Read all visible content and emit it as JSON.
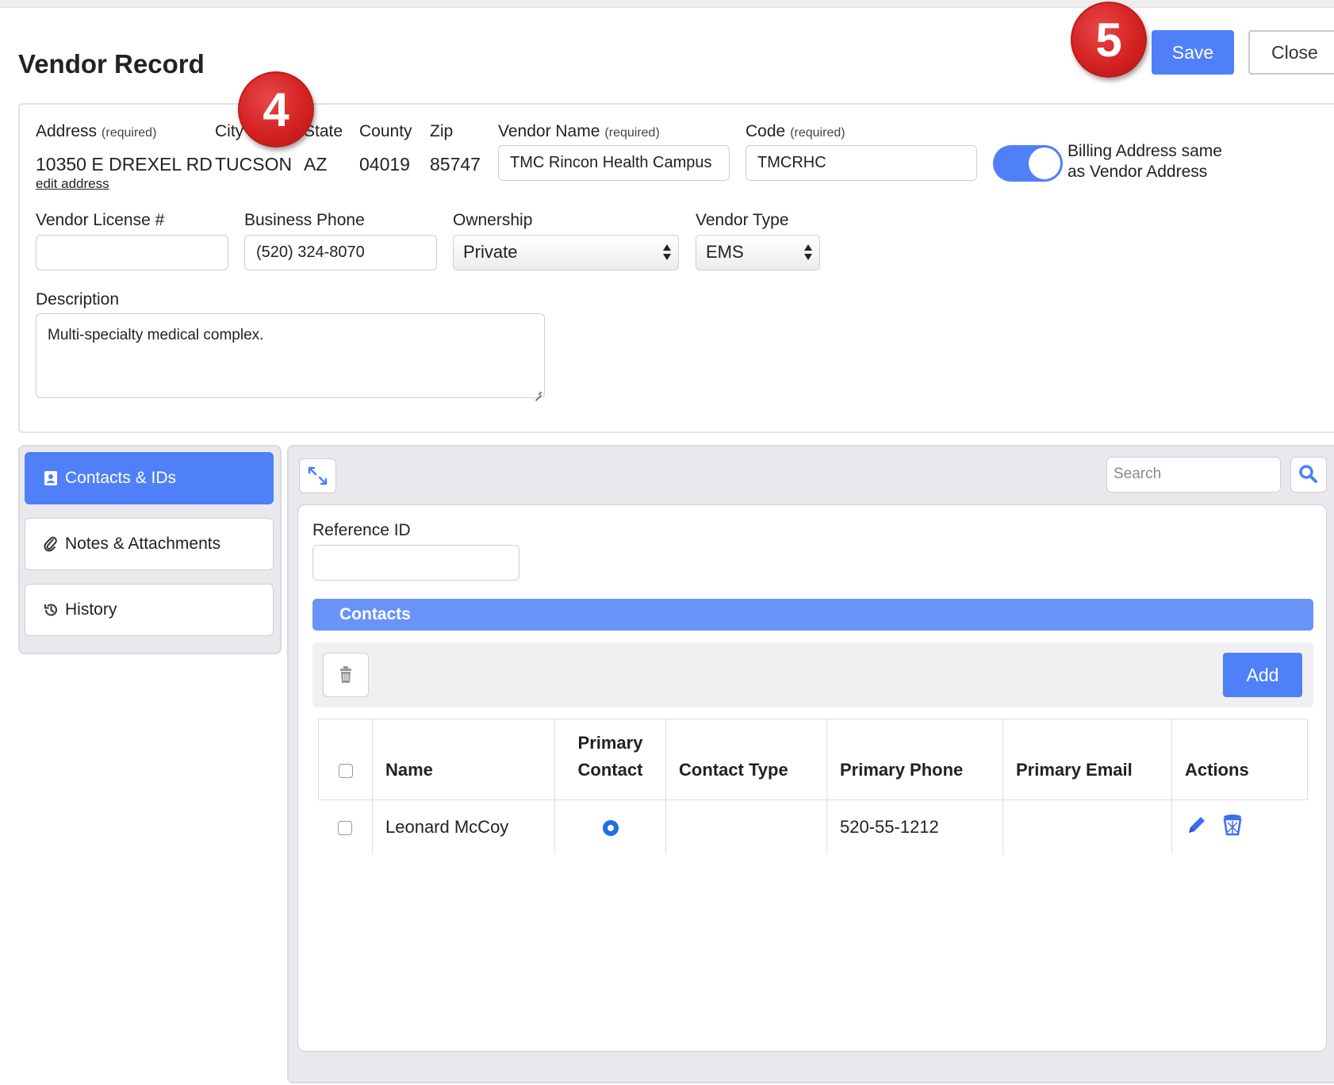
{
  "header": {
    "title": "Vendor Record",
    "save_label": "Save",
    "close_label": "Close"
  },
  "annotations": {
    "badge_4": "4",
    "badge_5": "5"
  },
  "address": {
    "address_label": "Address",
    "required_text": "(required)",
    "city_label": "City",
    "state_label": "State",
    "county_label": "County",
    "zip_label": "Zip",
    "street": "10350 E DREXEL RD",
    "city": "TUCSON",
    "state": "AZ",
    "county": "04019",
    "zip": "85747",
    "edit_link": "edit address"
  },
  "vendor": {
    "name_label": "Vendor Name",
    "name_value": "TMC Rincon Health Campus",
    "code_label": "Code",
    "code_value": "TMCRHC",
    "billing_toggle_label": "Billing Address same as Vendor Address",
    "billing_toggle_on": true,
    "license_label": "Vendor License #",
    "license_value": "",
    "phone_label": "Business Phone",
    "phone_value": "(520) 324-8070",
    "ownership_label": "Ownership",
    "ownership_value": "Private",
    "type_label": "Vendor Type",
    "type_value": "EMS",
    "description_label": "Description",
    "description_value": "Multi-specialty medical complex."
  },
  "sidebar": {
    "items": [
      {
        "label": "Contacts & IDs",
        "icon": "contact-card-icon",
        "active": true
      },
      {
        "label": "Notes & Attachments",
        "icon": "paperclip-icon",
        "active": false
      },
      {
        "label": "History",
        "icon": "history-icon",
        "active": false
      }
    ]
  },
  "main": {
    "search_placeholder": "Search",
    "reference_label": "Reference ID",
    "reference_value": "",
    "contacts_heading": "Contacts",
    "add_label": "Add",
    "table": {
      "headers": {
        "name": "Name",
        "primary_contact_line1": "Primary",
        "primary_contact_line2": "Contact",
        "contact_type": "Contact Type",
        "primary_phone": "Primary Phone",
        "primary_email": "Primary Email",
        "actions": "Actions"
      },
      "rows": [
        {
          "name": "Leonard McCoy",
          "primary_contact": true,
          "contact_type": "",
          "primary_phone": "520-55-1212",
          "primary_email": ""
        }
      ]
    }
  },
  "colors": {
    "accent": "#4f80f7",
    "contacts_bar": "#6a93f8",
    "badge_red": "#d42222"
  }
}
